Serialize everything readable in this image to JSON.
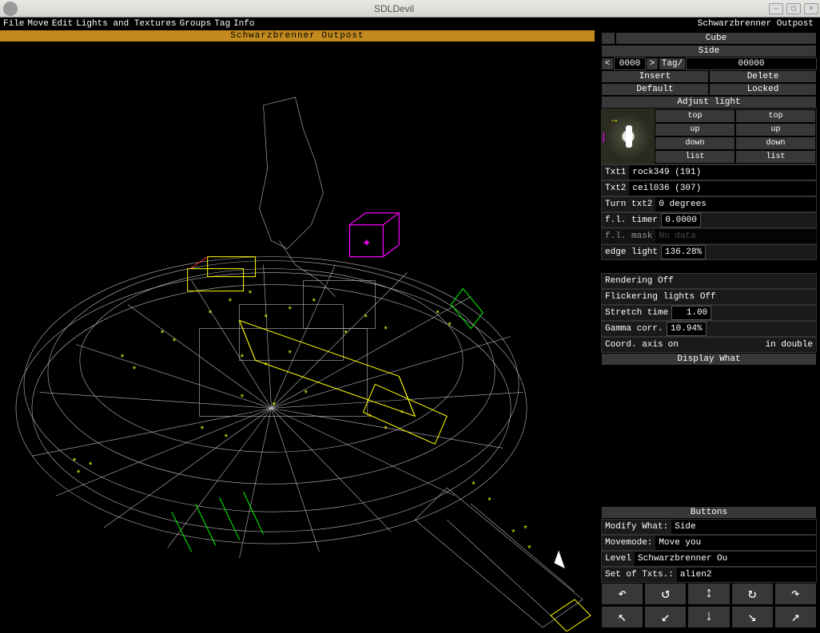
{
  "window": {
    "title": "SDLDevil"
  },
  "menu": {
    "items": [
      "File",
      "Move",
      "Edit",
      "Lights and Textures",
      "Groups",
      "Tag",
      "Info"
    ],
    "right_status": "Schwarzbrenner Outpost"
  },
  "level_title": "Schwarzbrenner Outpost",
  "cube_panel": {
    "tabs": {
      "narrow": "",
      "main": "Cube"
    },
    "side_label": "Side",
    "nav": {
      "prev": "<",
      "value": "0000",
      "next": ">",
      "tag_label": "Tag/",
      "tag_value": "00000"
    },
    "insert": "Insert",
    "delete": "Delete",
    "default": "Default",
    "locked": "Locked",
    "adjust": "Adjust light",
    "tex_buttons": {
      "top1": "top",
      "top2": "top",
      "up1": "up",
      "up2": "up",
      "down1": "down",
      "down2": "down",
      "list1": "list",
      "list2": "list"
    },
    "txt1_label": "Txt1",
    "txt1_value": "rock349 (191)",
    "txt2_label": "Txt2",
    "txt2_value": "ceil036 (307)",
    "turn_label": "Turn txt2",
    "turn_value": "0 degrees",
    "fl_timer_label": "f.l. timer",
    "fl_timer_value": "0.0000",
    "fl_mask_label": "f.l. mask",
    "fl_mask_value": "No data",
    "edge_light_label": "edge light",
    "edge_light_value": "136.28%"
  },
  "render_panel": {
    "rendering": "Rendering Off",
    "flicker": "Flickering lights Off",
    "stretch_label": "Stretch time",
    "stretch_value": "1.00",
    "gamma_label": "Gamma corr.",
    "gamma_value": "10.94%",
    "coord_label": "Coord. axis",
    "coord_state": "on",
    "coord_opt": "in double",
    "display_what": "Display What"
  },
  "buttons_panel": {
    "title": "Buttons",
    "modify_label": "Modify What:",
    "modify_value": "Side",
    "movemode_label": "Movemode:",
    "movemode_value": "Move you",
    "level_label": "Level",
    "level_value": "Schwarzbrenner Ou",
    "set_label": "Set of Txts.:",
    "set_value": "alien2",
    "arrows": [
      "↶",
      "↺",
      "↕",
      "↻",
      "↷",
      "↖",
      "↙",
      "↓",
      "↘",
      "↗"
    ]
  }
}
